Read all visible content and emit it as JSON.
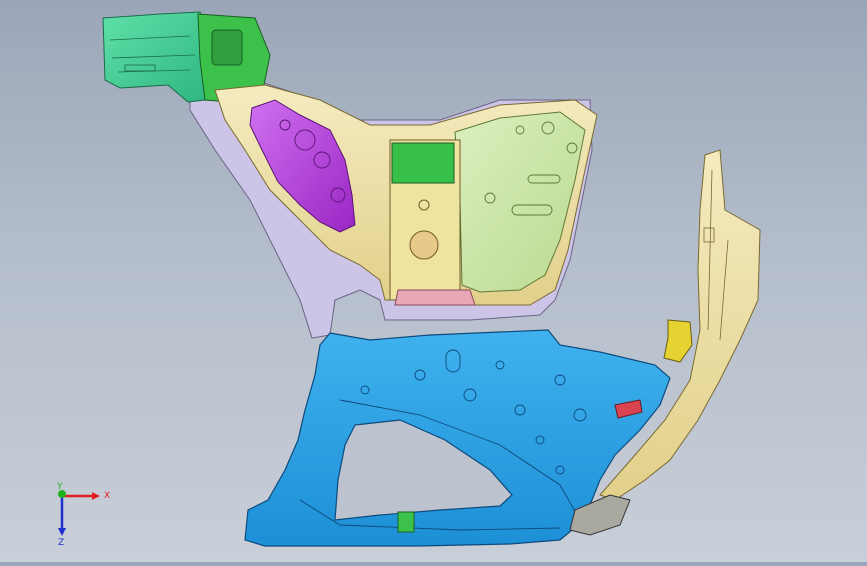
{
  "viewport": {
    "background_top": "#9aa6b8",
    "background_bottom": "#c9cfd8"
  },
  "model": {
    "parts": [
      {
        "name": "green-mint-rear-rail",
        "color": "#47d29a"
      },
      {
        "name": "green-bracket-upper",
        "color": "#3cc24b"
      },
      {
        "name": "lavender-inner-panel",
        "color": "#cbc4e6"
      },
      {
        "name": "purple-reinforcement",
        "color": "#b03ad8"
      },
      {
        "name": "pale-green-wheelhouse",
        "color": "#c9e3a6"
      },
      {
        "name": "tan-pillar-structure",
        "color": "#efe2a6"
      },
      {
        "name": "blue-side-panel",
        "color": "#2aa1e4"
      },
      {
        "name": "pink-lower-bracket",
        "color": "#e8a7b4"
      },
      {
        "name": "yellow-hinge-bracket",
        "color": "#e6d230"
      }
    ]
  },
  "triad": {
    "x_label": "X",
    "y_label": "Y",
    "z_label": "Z",
    "x_color": "#e02020",
    "y_color": "#20b020",
    "z_color": "#2030d0"
  }
}
